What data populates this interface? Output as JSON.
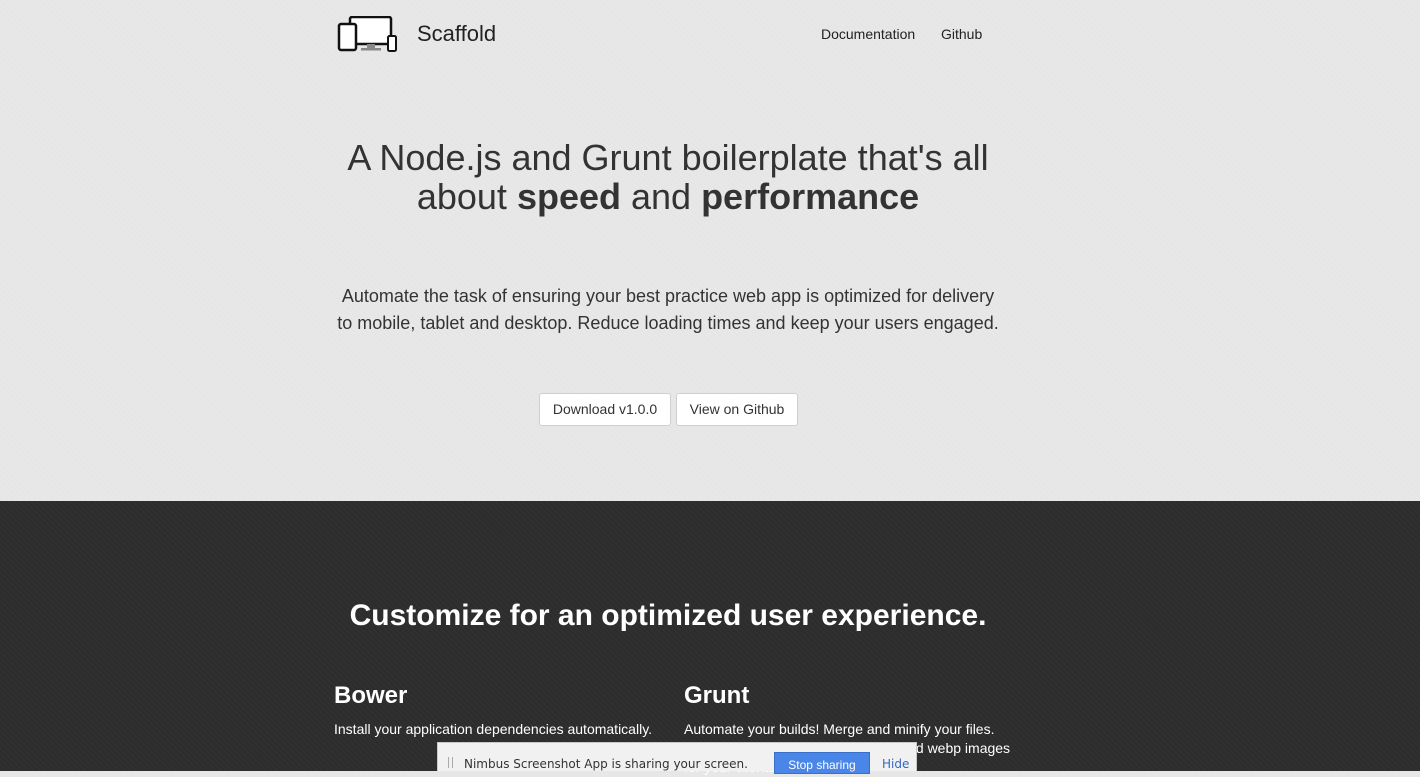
{
  "header": {
    "brand": "Scaffold",
    "logo_icon": "devices-icon",
    "nav": [
      {
        "label": "Documentation"
      },
      {
        "label": "Github"
      }
    ]
  },
  "hero": {
    "headline_part1": "A Node.js and Grunt boilerplate that's all about ",
    "headline_bold1": "speed",
    "headline_part2": " and ",
    "headline_bold2": "performance",
    "lead": "Automate the task of ensuring your best practice web app is optimized for delivery to mobile, tablet and desktop. Reduce loading times and keep your users engaged.",
    "buttons": {
      "download": "Download v1.0.0",
      "github": "View on Github"
    }
  },
  "features": {
    "title": "Customize for an optimized user experience.",
    "items": [
      {
        "title": "Bower",
        "text": "Install your application dependencies automatically."
      },
      {
        "title": "Grunt",
        "text": "Automate your builds! Merge and minify your files. Generate sprites, cache manifests and webp images for your clients."
      }
    ]
  },
  "share_bar": {
    "message": "Nimbus Screenshot App is sharing your screen.",
    "stop_label": "Stop sharing",
    "hide_label": "Hide"
  },
  "colors": {
    "hero_bg": "#e6e6e6",
    "dark_bg": "#2d2d2d",
    "share_button": "#4a86e8"
  }
}
